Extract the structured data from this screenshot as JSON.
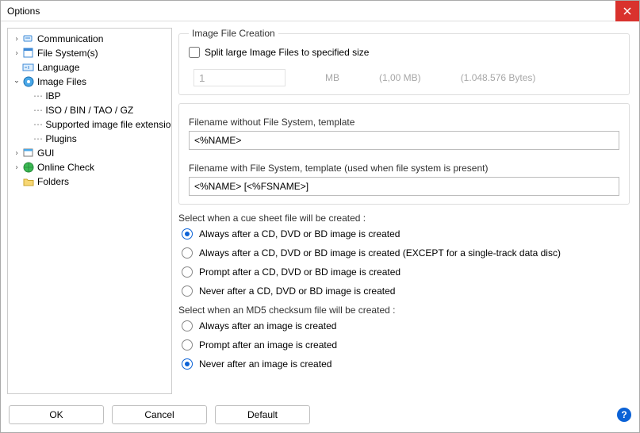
{
  "window": {
    "title": "Options"
  },
  "tree": {
    "items": [
      {
        "label": "Communication",
        "expandable": true,
        "expanded": false
      },
      {
        "label": "File System(s)",
        "expandable": true,
        "expanded": false
      },
      {
        "label": "Language",
        "expandable": false
      },
      {
        "label": "Image Files",
        "expandable": true,
        "expanded": true,
        "selected": true,
        "children": [
          {
            "label": "IBP"
          },
          {
            "label": "ISO / BIN / TAO / GZ"
          },
          {
            "label": "Supported image file extensions"
          },
          {
            "label": "Plugins"
          }
        ]
      },
      {
        "label": "GUI",
        "expandable": true,
        "expanded": false
      },
      {
        "label": "Online Check",
        "expandable": true,
        "expanded": false
      },
      {
        "label": "Folders",
        "expandable": false
      }
    ]
  },
  "image_file_creation": {
    "legend": "Image File Creation",
    "split_checkbox_label": "Split large Image Files to specified size",
    "split_checked": false,
    "split_value": "1",
    "split_unit": "MB",
    "split_mb_display": "(1,00 MB)",
    "split_bytes_display": "(1.048.576 Bytes)",
    "template_no_fs_label": "Filename without File System, template",
    "template_no_fs_value": "<%NAME>",
    "template_with_fs_label": "Filename with File System, template (used when file system is present)",
    "template_with_fs_value": "<%NAME> [<%FSNAME>]"
  },
  "cue": {
    "heading": "Select when a cue sheet file will be created :",
    "options": [
      "Always after a CD, DVD or BD image is created",
      "Always after a CD, DVD or BD image is created (EXCEPT for a single-track data disc)",
      "Prompt after a CD, DVD or BD image is created",
      "Never after a CD, DVD or BD image is created"
    ],
    "selected_index": 0
  },
  "md5": {
    "heading": "Select when an MD5 checksum file will be created :",
    "options": [
      "Always after an image is created",
      "Prompt after an image is created",
      "Never after an image is created"
    ],
    "selected_index": 2
  },
  "buttons": {
    "ok": "OK",
    "cancel": "Cancel",
    "default": "Default"
  }
}
